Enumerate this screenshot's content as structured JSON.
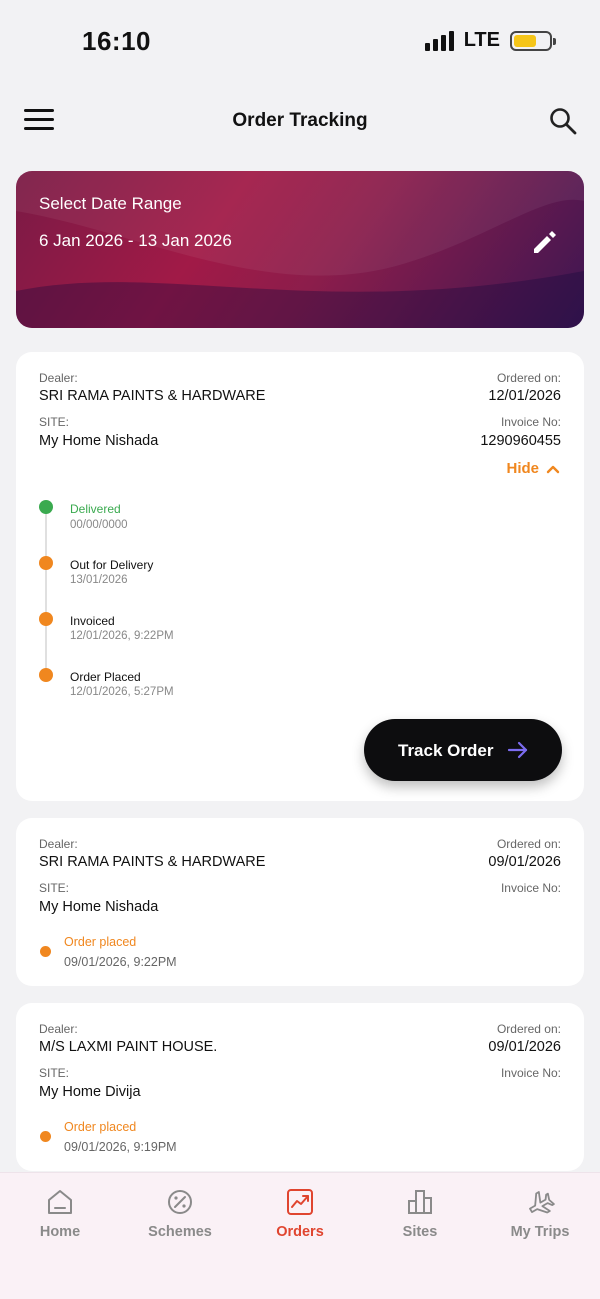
{
  "status_bar": {
    "time": "16:10",
    "network": "LTE"
  },
  "header": {
    "title": "Order Tracking"
  },
  "date_range": {
    "label": "Select Date Range",
    "value": "6 Jan 2026 - 13 Jan 2026"
  },
  "labels": {
    "dealer": "Dealer:",
    "site": "SITE:",
    "ordered_on": "Ordered on:",
    "invoice_no": "Invoice No:"
  },
  "orders": [
    {
      "dealer": "SRI RAMA PAINTS & HARDWARE",
      "site": "My Home Nishada",
      "ordered_on": "12/01/2026",
      "invoice_no": "1290960455",
      "toggle_label": "Hide",
      "timeline": [
        {
          "title": "Delivered",
          "date": "00/00/0000"
        },
        {
          "title": "Out for Delivery",
          "date": "13/01/2026"
        },
        {
          "title": "Invoiced",
          "date": "12/01/2026, 9:22PM"
        },
        {
          "title": "Order Placed",
          "date": "12/01/2026, 5:27PM"
        }
      ],
      "track_button": "Track Order"
    },
    {
      "dealer": "SRI RAMA PAINTS & HARDWARE",
      "site": "My Home Nishada",
      "ordered_on": "09/01/2026",
      "invoice_no": "",
      "status": "Order placed",
      "status_date": "09/01/2026, 9:22PM"
    },
    {
      "dealer": "M/S LAXMI PAINT HOUSE.",
      "site": "My Home Divija",
      "ordered_on": "09/01/2026",
      "invoice_no": "",
      "status": "Order placed",
      "status_date": "09/01/2026, 9:19PM"
    }
  ],
  "bottom_nav": {
    "items": [
      {
        "label": "Home",
        "icon": "home-icon"
      },
      {
        "label": "Schemes",
        "icon": "schemes-icon"
      },
      {
        "label": "Orders",
        "icon": "orders-icon"
      },
      {
        "label": "Sites",
        "icon": "sites-icon"
      },
      {
        "label": "My Trips",
        "icon": "plane-icon"
      }
    ],
    "active": "Orders"
  },
  "colors": {
    "accent_orange": "#f0871f",
    "delivered_green": "#3aaa4f",
    "active_nav": "#e0452f",
    "card_gradient_start": "#a11a47",
    "card_gradient_end": "#3c1652"
  }
}
